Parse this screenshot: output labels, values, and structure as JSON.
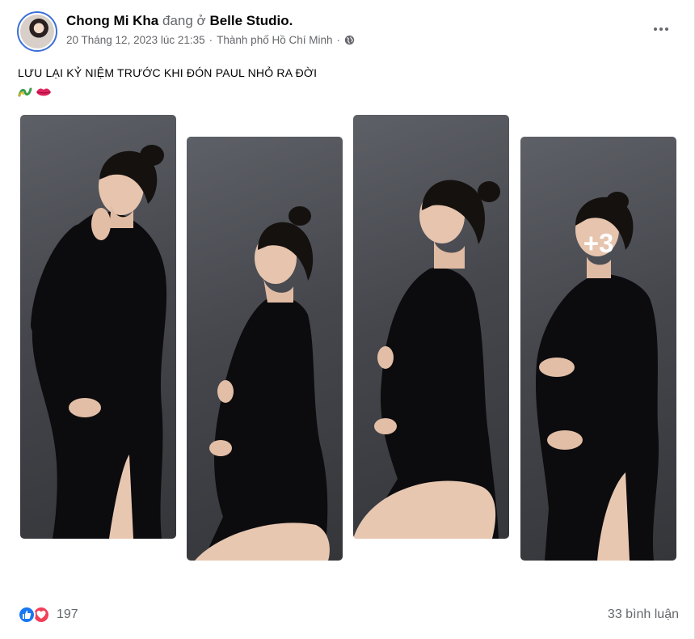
{
  "post": {
    "author": "Chong Mi Kha",
    "connector": "đang ở",
    "place": "Belle Studio.",
    "date": "20 Tháng 12, 2023 lúc 21:35",
    "separator": "·",
    "location": "Thành phố Hồ Chí Minh",
    "privacy_icon": "globe-icon",
    "caption": "LƯU LẠI KỶ NIỆM TRƯỚC KHI ĐÓN PAUL NHỎ RA ĐỜI",
    "caption_emojis": [
      "wavy-squiggle-emoji",
      "lips-emoji"
    ],
    "photos": [
      {
        "name": "maternity-photo-1",
        "pose": "standing-hand-on-cheek"
      },
      {
        "name": "maternity-photo-2",
        "pose": "kneeling-profile"
      },
      {
        "name": "maternity-photo-3",
        "pose": "kneeling-smiling"
      },
      {
        "name": "maternity-photo-4",
        "pose": "standing-hands-on-belly"
      }
    ],
    "more_photos_label": "+3",
    "reactions": {
      "icons": [
        "like-icon",
        "love-icon"
      ],
      "count": "197"
    },
    "comments_label": "33 bình luận"
  },
  "colors": {
    "link_blue": "#1877f2",
    "love_red": "#f33e58",
    "secondary_text": "#65676b",
    "photo_background": "#45474d",
    "dress": "#0c0c0e"
  }
}
